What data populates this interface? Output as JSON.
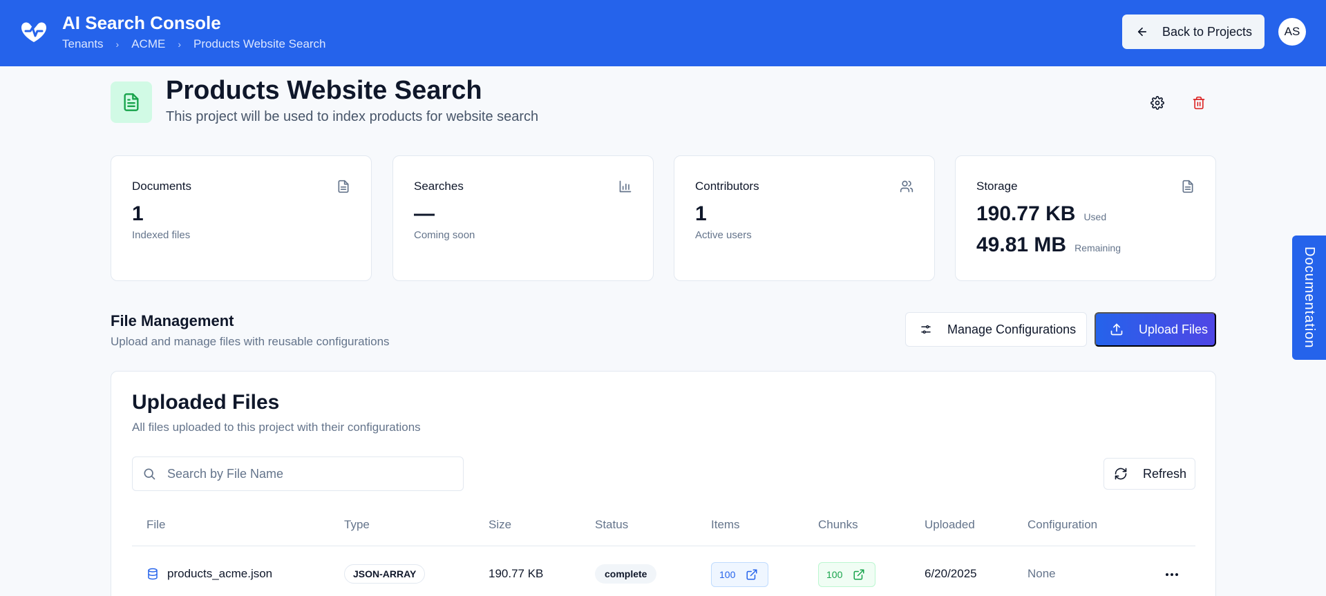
{
  "app": {
    "title": "AI Search Console",
    "breadcrumbs": [
      "Tenants",
      "ACME",
      "Products Website Search"
    ],
    "back_label": "Back to Projects",
    "avatar_initials": "AS",
    "brand_color": "#2563eb"
  },
  "project": {
    "title": "Products Website Search",
    "description": "This project will be used to index products for website search",
    "icon": "document-icon"
  },
  "stats": {
    "documents": {
      "label": "Documents",
      "value": "1",
      "sub": "Indexed files",
      "icon": "document-icon"
    },
    "searches": {
      "label": "Searches",
      "value": "—",
      "sub": "Coming soon",
      "icon": "bar-chart-icon"
    },
    "contributors": {
      "label": "Contributors",
      "value": "1",
      "sub": "Active users",
      "icon": "users-icon"
    },
    "storage": {
      "label": "Storage",
      "used_value": "190.77 KB",
      "used_label": "Used",
      "remaining_value": "49.81 MB",
      "remaining_label": "Remaining",
      "icon": "document-icon"
    }
  },
  "file_management": {
    "title": "File Management",
    "subtitle": "Upload and manage files with reusable configurations",
    "manage_label": "Manage Configurations",
    "upload_label": "Upload Files"
  },
  "uploaded_files": {
    "title": "Uploaded Files",
    "subtitle": "All files uploaded to this project with their configurations",
    "search_placeholder": "Search by File Name",
    "refresh_label": "Refresh",
    "columns": [
      "File",
      "Type",
      "Size",
      "Status",
      "Items",
      "Chunks",
      "Uploaded",
      "Configuration"
    ],
    "rows": [
      {
        "file": "products_acme.json",
        "type": "JSON-ARRAY",
        "size": "190.77 KB",
        "status": "complete",
        "items": "100",
        "chunks": "100",
        "uploaded": "6/20/2025",
        "configuration": "None"
      }
    ]
  },
  "documentation_tab": "Documentation"
}
